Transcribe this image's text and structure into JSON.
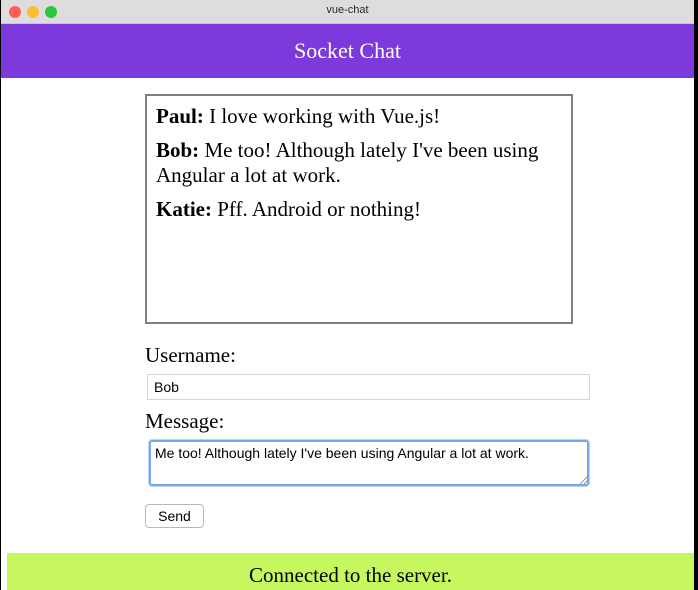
{
  "window": {
    "title": "vue-chat"
  },
  "header": {
    "title": "Socket Chat"
  },
  "messages": [
    {
      "user": "Paul:",
      "text": " I love working with Vue.js!"
    },
    {
      "user": "Bob:",
      "text": " Me too! Although lately I've been using Angular a lot at work."
    },
    {
      "user": "Katie:",
      "text": " Pff. Android or nothing!"
    }
  ],
  "form": {
    "username_label": "Username:",
    "username_value": "Bob",
    "message_label": "Message:",
    "message_value": "Me too! Although lately I've been using Angular a lot at work.",
    "send_label": "Send"
  },
  "status": {
    "text": "Connected to the server.",
    "color": "#c6f75e"
  },
  "colors": {
    "header": "#7d39db",
    "focus": "#78a6ea"
  }
}
